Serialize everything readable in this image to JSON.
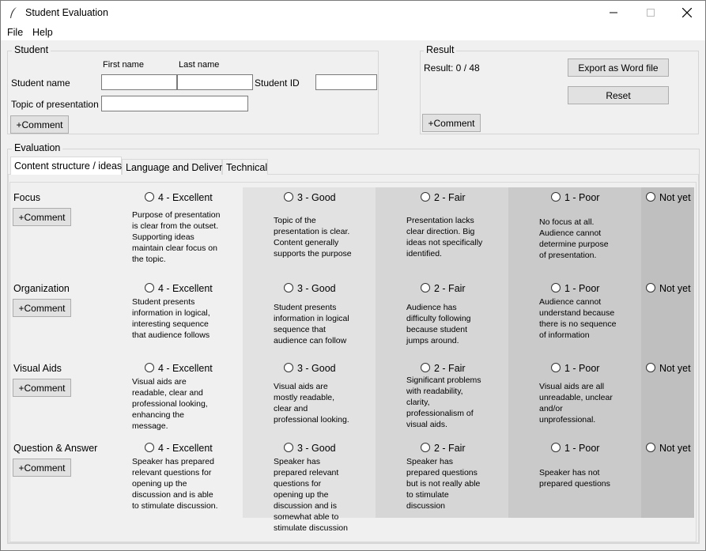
{
  "window": {
    "title": "Student Evaluation"
  },
  "menu": [
    "File",
    "Help"
  ],
  "student": {
    "group_label": "Student",
    "first_name_label": "First name",
    "last_name_label": "Last name",
    "name_label": "Student name",
    "id_label": "Student ID",
    "topic_label": "Topic of presentation",
    "first_name_value": "",
    "last_name_value": "",
    "id_value": "",
    "topic_value": "",
    "comment_button": "+Comment"
  },
  "result": {
    "group_label": "Result",
    "text": "Result: 0 / 48",
    "export_button": "Export as Word file",
    "reset_button": "Reset",
    "comment_button": "+Comment"
  },
  "evaluation": {
    "group_label": "Evaluation",
    "tabs": [
      "Content structure / ideas",
      "Language and Delivery",
      "Technical"
    ],
    "active_tab": 0,
    "column_colors": [
      "#f0f0f0",
      "#e2e2e2",
      "#d6d6d6",
      "#cacaca",
      "#bfbfbf"
    ],
    "levels": [
      "4 - Excellent",
      "3 - Good",
      "2 - Fair",
      "1 - Poor",
      "Not yet"
    ],
    "criteria": [
      {
        "name": "Focus",
        "comment": "+Comment",
        "descriptions": [
          "Purpose of presentation is clear from the outset. Supporting ideas maintain clear focus on the topic.",
          "Topic of the presentation is clear. Content generally supports the purpose",
          "Presentation lacks clear direction. Big ideas not specifically identified.",
          "No focus at all. Audience cannot determine purpose of presentation."
        ]
      },
      {
        "name": "Organization",
        "comment": "+Comment",
        "descriptions": [
          "Student presents information in logical, interesting sequence that audience follows",
          "Student presents information in logical sequence that audience can follow",
          "Audience has difficulty following because student jumps around.",
          "Audience cannot understand because there is no sequence of information"
        ]
      },
      {
        "name": "Visual Aids",
        "comment": "+Comment",
        "descriptions": [
          "Visual aids are readable, clear and professional looking, enhancing the message.",
          "Visual aids are mostly readable, clear and professional looking.",
          "Significant problems with readability, clarity, professionalism of visual aids.",
          "Visual aids are all unreadable, unclear and/or unprofessional."
        ]
      },
      {
        "name": "Question & Answer",
        "comment": "+Comment",
        "descriptions": [
          "Speaker has prepared relevant questions for opening up the discussion and is able to stimulate discussion.",
          "Speaker has prepared relevant questions for opening up the discussion and is somewhat able to stimulate discussion",
          "Speaker has prepared questions but is not really able to stimulate discussion",
          "Speaker has not prepared questions"
        ]
      }
    ]
  }
}
